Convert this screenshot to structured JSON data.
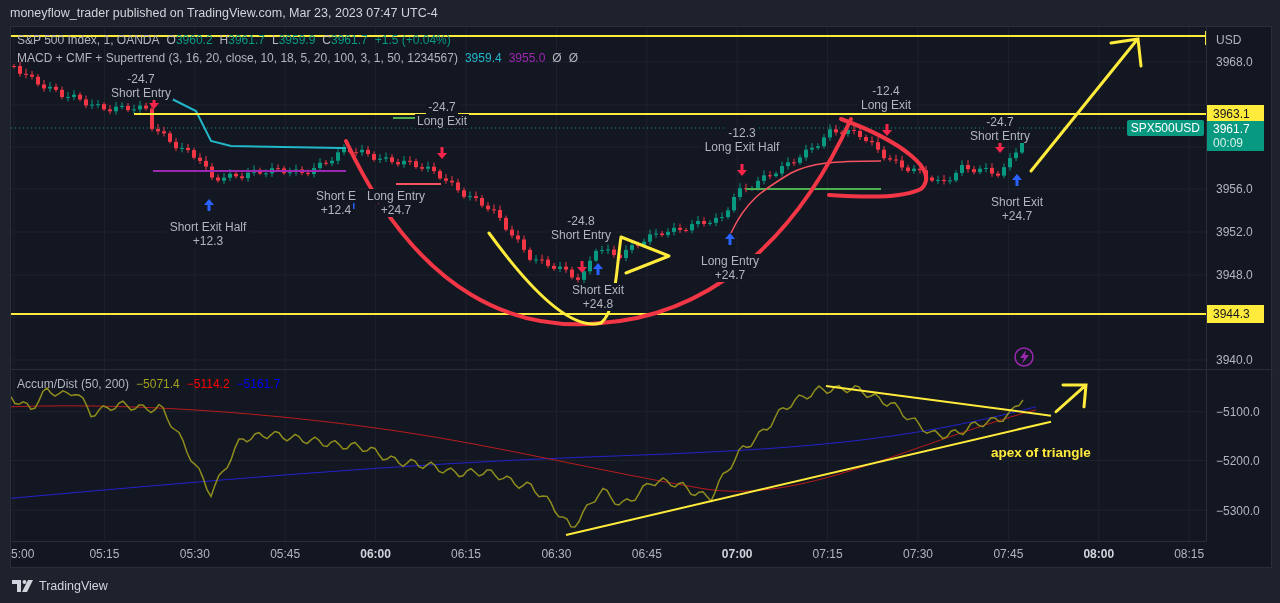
{
  "header": {
    "title": "moneyflow_trader published on TradingView.com, Mar 23, 2023 07:47 UTC-4"
  },
  "legend": {
    "symbol": "S&P 500 Index, 1, OANDA",
    "ohlc": [
      {
        "key": "O",
        "value": "3960.2"
      },
      {
        "key": "H",
        "value": "3961.7"
      },
      {
        "key": "L",
        "value": "3959.9"
      },
      {
        "key": "C",
        "value": "3961.7"
      }
    ],
    "change": "+1.5 (+0.04%)",
    "indicator": {
      "name": "MACD + CMF + Supertrend (3, 16, 20, close, 10, 18, 5, 20, 100, 3, 1, 50, 1234567)",
      "values": [
        {
          "value": "3959.4",
          "color": "#22b7c9"
        },
        {
          "value": "3955.0",
          "color": "#9c27b0"
        },
        {
          "value": "Ø",
          "color": "#b2b5be"
        },
        {
          "value": "Ø",
          "color": "#b2b5be"
        }
      ]
    }
  },
  "signals": [
    {
      "kind": "above",
      "lines": [
        "-24.7",
        "Short Entry"
      ]
    },
    {
      "kind": "above",
      "lines": [
        "-24.7",
        "Long Exit"
      ]
    },
    {
      "kind": "below",
      "lines": [
        "Short Exit Half",
        "+12.3"
      ]
    },
    {
      "kind": "below",
      "lines": [
        "Short E",
        "+12.4"
      ]
    },
    {
      "kind": "below",
      "lines": [
        "Long Entry",
        "+24.7"
      ]
    },
    {
      "kind": "above",
      "lines": [
        "-24.8",
        "Short Entry"
      ]
    },
    {
      "kind": "below",
      "lines": [
        "Short Exit",
        "+24.8"
      ]
    },
    {
      "kind": "above",
      "lines": [
        "-12.3",
        "Long Exit Half"
      ]
    },
    {
      "kind": "below",
      "lines": [
        "Long Entry",
        "+24.7"
      ]
    },
    {
      "kind": "above",
      "lines": [
        "-12.4",
        "Long Exit"
      ]
    },
    {
      "kind": "above",
      "lines": [
        "-24.7",
        "Short Entry"
      ]
    },
    {
      "kind": "below",
      "lines": [
        "Short Exit",
        "+24.7"
      ]
    }
  ],
  "price_axis": {
    "unit": "USD",
    "labels": [
      "3968.0",
      "3956.0",
      "3952.0",
      "3948.0",
      "3940.0"
    ],
    "tags": [
      "3963.1",
      "3944.3"
    ],
    "last_price": {
      "symbol": "SPX500USD",
      "value": "3961.7",
      "countdown": "00:09"
    }
  },
  "accum_dist": {
    "name": "Accum/Dist (50, 200)",
    "values": [
      {
        "value": "−5071.4",
        "color": "#a3a01e"
      },
      {
        "value": "−5114.2",
        "color": "#ff0000"
      },
      {
        "value": "−5161.7",
        "color": "#0000ff"
      }
    ],
    "axis_labels": [
      "−5100.0",
      "−5200.0",
      "−5300.0"
    ],
    "annotation": "apex of triangle"
  },
  "time_axis": [
    {
      "label": "5:00",
      "major": false
    },
    {
      "label": "05:15",
      "major": false
    },
    {
      "label": "05:30",
      "major": false
    },
    {
      "label": "05:45",
      "major": false
    },
    {
      "label": "06:00",
      "major": true
    },
    {
      "label": "06:15",
      "major": false
    },
    {
      "label": "06:30",
      "major": false
    },
    {
      "label": "06:45",
      "major": false
    },
    {
      "label": "07:00",
      "major": true
    },
    {
      "label": "07:15",
      "major": false
    },
    {
      "label": "07:30",
      "major": false
    },
    {
      "label": "07:45",
      "major": false
    },
    {
      "label": "08:00",
      "major": true
    },
    {
      "label": "08:15",
      "major": false
    }
  ],
  "footer": {
    "brand": "TradingView"
  }
}
